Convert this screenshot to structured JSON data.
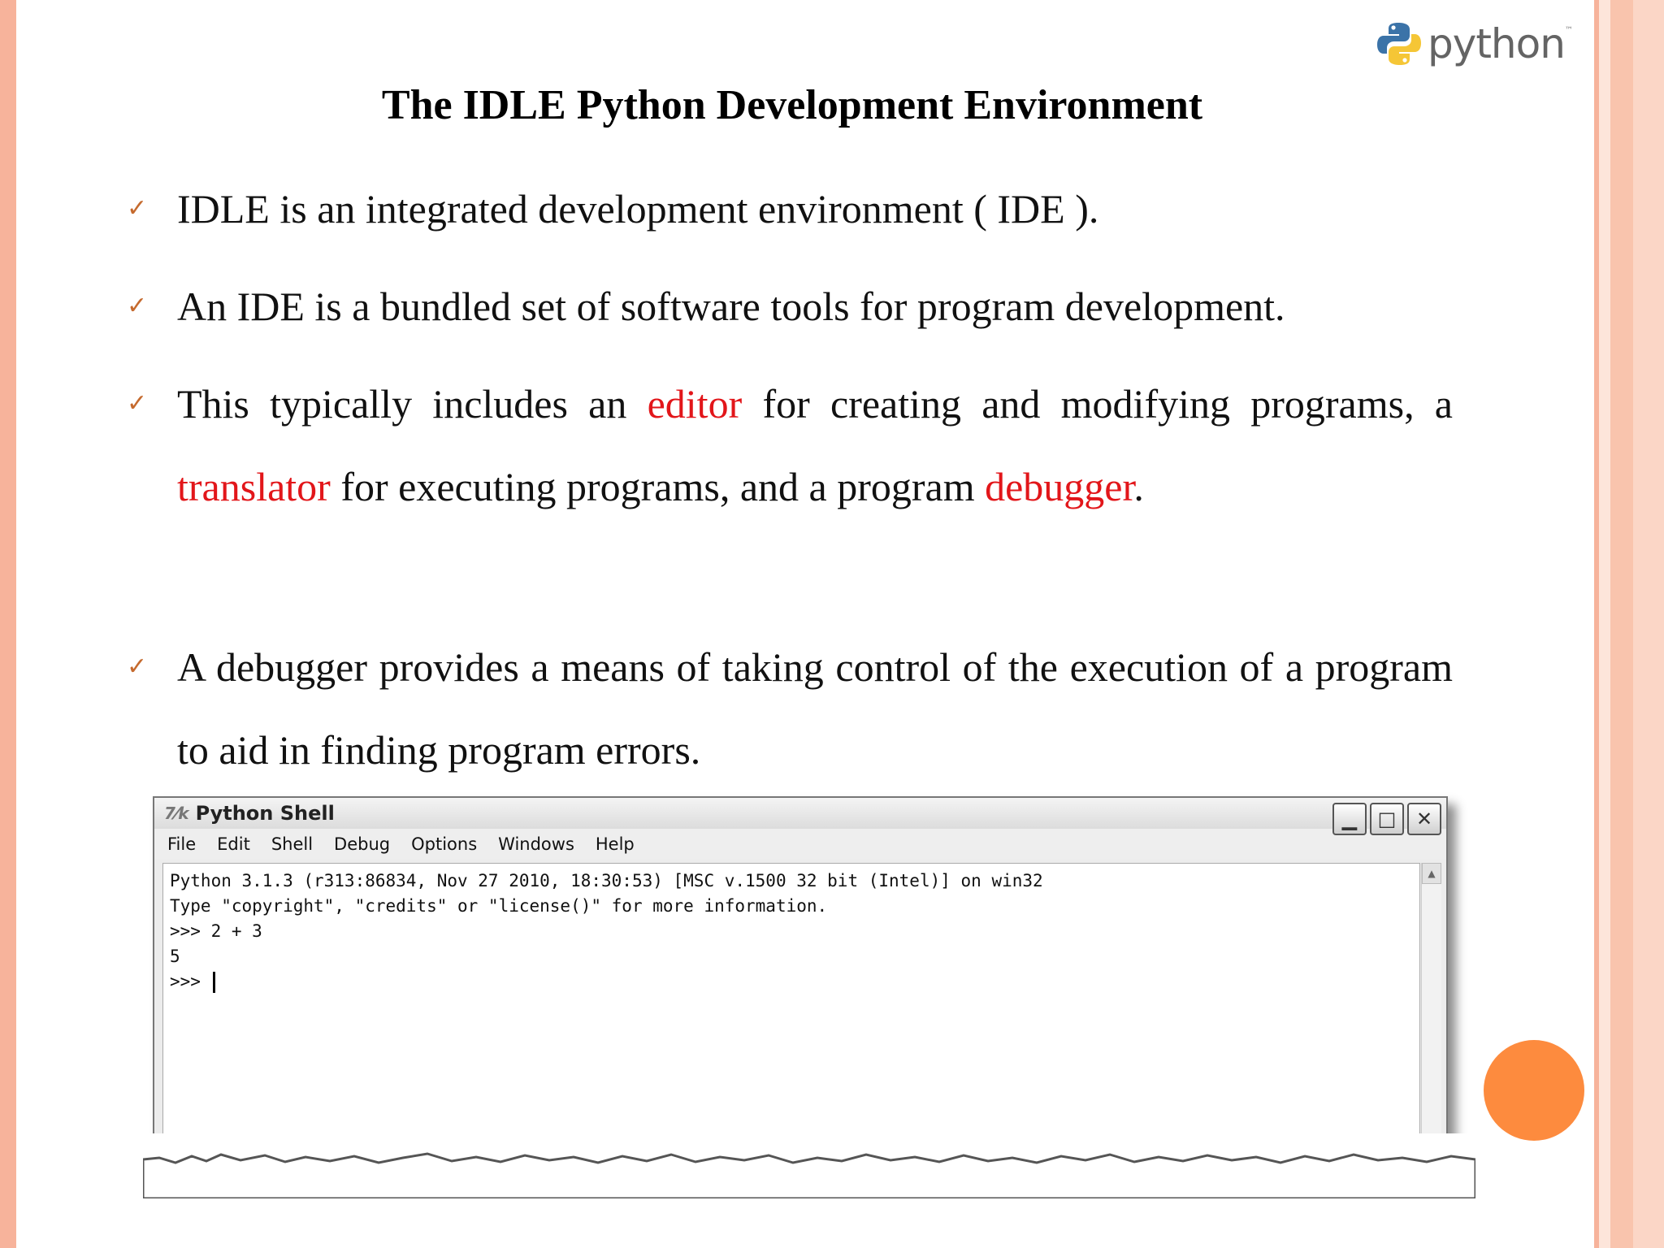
{
  "logo": {
    "word": "python",
    "tm": "™"
  },
  "title": "The IDLE Python Development Environment",
  "bullets": {
    "b1": "IDLE is an integrated development environment ( IDE ).",
    "b2": "An IDE is a bundled set of software tools for program development.",
    "b3": {
      "t1": "This typically includes an ",
      "editor": "editor",
      "t2": " for creating and modifying programs, a ",
      "translator": "translator",
      "t3": " for executing programs, and a program ",
      "debugger": "debugger",
      "t4": "."
    },
    "b4": "A debugger provides a means of taking control of the execution of a program to aid in finding program errors."
  },
  "check_icon": "✓",
  "accent_color": "#e2161a",
  "shell": {
    "title": "Python Shell",
    "icon": "7⁄k",
    "buttons": {
      "minimize": "▁",
      "maximize": "□",
      "close": "✕"
    },
    "menu": [
      "File",
      "Edit",
      "Shell",
      "Debug",
      "Options",
      "Windows",
      "Help"
    ],
    "lines": [
      "Python 3.1.3 (r313:86834, Nov 27 2010, 18:30:53) [MSC v.1500 32 bit (Intel)] on win32",
      "Type \"copyright\", \"credits\" or \"license()\" for more information.",
      ">>> 2 + 3",
      "5"
    ],
    "prompt": ">>> "
  }
}
